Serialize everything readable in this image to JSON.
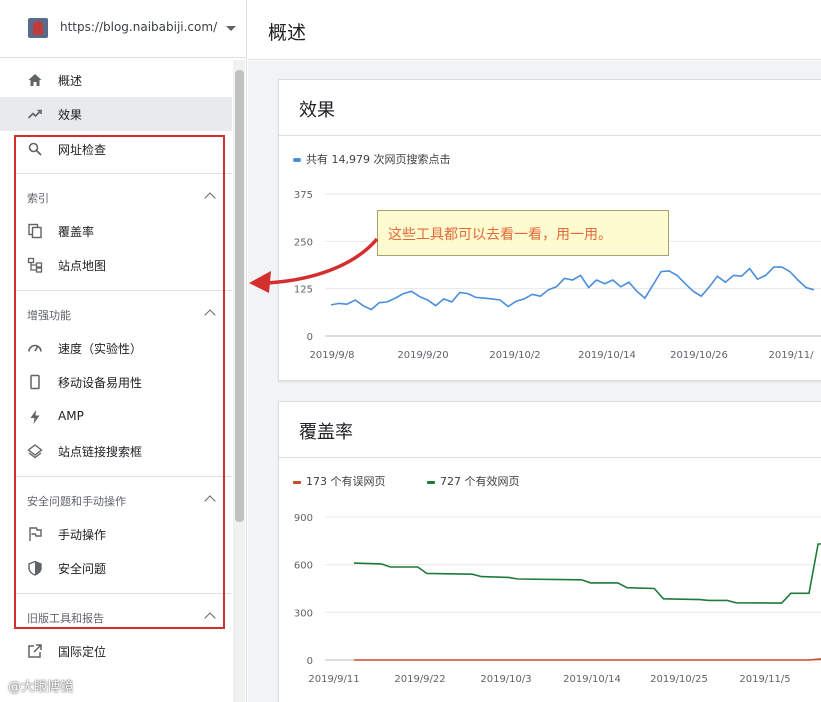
{
  "property": {
    "url": "https://blog.naibabiji.com/"
  },
  "page": {
    "title": "概述"
  },
  "sidebar": {
    "top_items": [
      {
        "label": "概述",
        "icon": "home-icon"
      },
      {
        "label": "效果",
        "icon": "trending-up-icon"
      },
      {
        "label": "网址检查",
        "icon": "search-icon"
      }
    ],
    "sections": [
      {
        "title": "索引",
        "items": [
          {
            "label": "覆盖率",
            "icon": "copy-icon"
          },
          {
            "label": "站点地图",
            "icon": "sitemap-icon"
          }
        ]
      },
      {
        "title": "增强功能",
        "items": [
          {
            "label": "速度（实验性）",
            "icon": "speed-icon"
          },
          {
            "label": "移动设备易用性",
            "icon": "phone-icon"
          },
          {
            "label": "AMP",
            "icon": "bolt-icon"
          },
          {
            "label": "站点链接搜索框",
            "icon": "layers-icon"
          }
        ]
      },
      {
        "title": "安全问题和手动操作",
        "items": [
          {
            "label": "手动操作",
            "icon": "flag-icon"
          },
          {
            "label": "安全问题",
            "icon": "shield-icon"
          }
        ]
      },
      {
        "title": "旧版工具和报告",
        "items": [
          {
            "label": "国际定位",
            "icon": "external-link-icon"
          }
        ]
      }
    ]
  },
  "callout": {
    "text": "这些工具都可以去看一看，用一用。"
  },
  "watermark": {
    "text": "@大眼博镜"
  },
  "colors": {
    "blue": "#4a8fdc",
    "green": "#1e7b3a",
    "red": "#c94a2b",
    "annotation_red": "#d32f2f"
  },
  "cards": {
    "performance": {
      "title": "效果",
      "legend": "共有 14,979 次网页搜索点击",
      "chart_data": {
        "type": "line",
        "ylim": [
          0,
          375
        ],
        "yticks": [
          0,
          125,
          250,
          375
        ],
        "xtick_labels": [
          "2019/9/8",
          "2019/9/20",
          "2019/10/2",
          "2019/10/14",
          "2019/10/26",
          "2019/11/"
        ],
        "series": [
          {
            "name": "共有 14,979 次网页搜索点击",
            "color": "#4a8fdc",
            "values": [
              82,
              86,
              84,
              95,
              80,
              70,
              88,
              90,
              100,
              112,
              118,
              104,
              95,
              80,
              98,
              90,
              115,
              112,
              102,
              100,
              98,
              95,
              78,
              92,
              98,
              110,
              105,
              122,
              130,
              152,
              148,
              160,
              128,
              148,
              138,
              148,
              130,
              142,
              118,
              100,
              135,
              170,
              172,
              160,
              138,
              118,
              105,
              130,
              158,
              142,
              160,
              158,
              178,
              150,
              160,
              182,
              182,
              170,
              148,
              128,
              122
            ]
          }
        ]
      }
    },
    "coverage": {
      "title": "覆盖率",
      "legend_items": [
        {
          "label": "173 个有误网页",
          "color": "#c94a2b"
        },
        {
          "label": "727 个有效网页",
          "color": "#1e7b3a"
        }
      ],
      "chart_data": {
        "type": "line",
        "ylim": [
          0,
          900
        ],
        "yticks": [
          0,
          300,
          600,
          900
        ],
        "xtick_labels": [
          "2019/9/11",
          "2019/9/22",
          "2019/10/3",
          "2019/10/14",
          "2019/10/25",
          "2019/11/5"
        ],
        "series": [
          {
            "name": "173 个有误网页",
            "color": "#c94a2b",
            "points": [
              [
                0,
                0
              ],
              [
                50,
                0
              ],
              [
                52,
                10
              ],
              [
                53,
                10
              ],
              [
                54,
                150
              ],
              [
                55,
                150
              ]
            ]
          },
          {
            "name": "727 个有效网页",
            "color": "#1e7b3a",
            "points": [
              [
                0,
                610
              ],
              [
                3,
                605
              ],
              [
                4,
                585
              ],
              [
                7,
                585
              ],
              [
                8,
                545
              ],
              [
                13,
                540
              ],
              [
                14,
                525
              ],
              [
                17,
                520
              ],
              [
                18,
                510
              ],
              [
                25,
                505
              ],
              [
                26,
                485
              ],
              [
                29,
                485
              ],
              [
                30,
                455
              ],
              [
                33,
                450
              ],
              [
                34,
                385
              ],
              [
                38,
                380
              ],
              [
                39,
                375
              ],
              [
                41,
                375
              ],
              [
                42,
                360
              ],
              [
                47,
                358
              ],
              [
                48,
                420
              ],
              [
                50,
                420
              ],
              [
                51,
                730
              ],
              [
                53,
                730
              ],
              [
                54,
                745
              ],
              [
                55,
                745
              ]
            ]
          }
        ]
      }
    }
  }
}
